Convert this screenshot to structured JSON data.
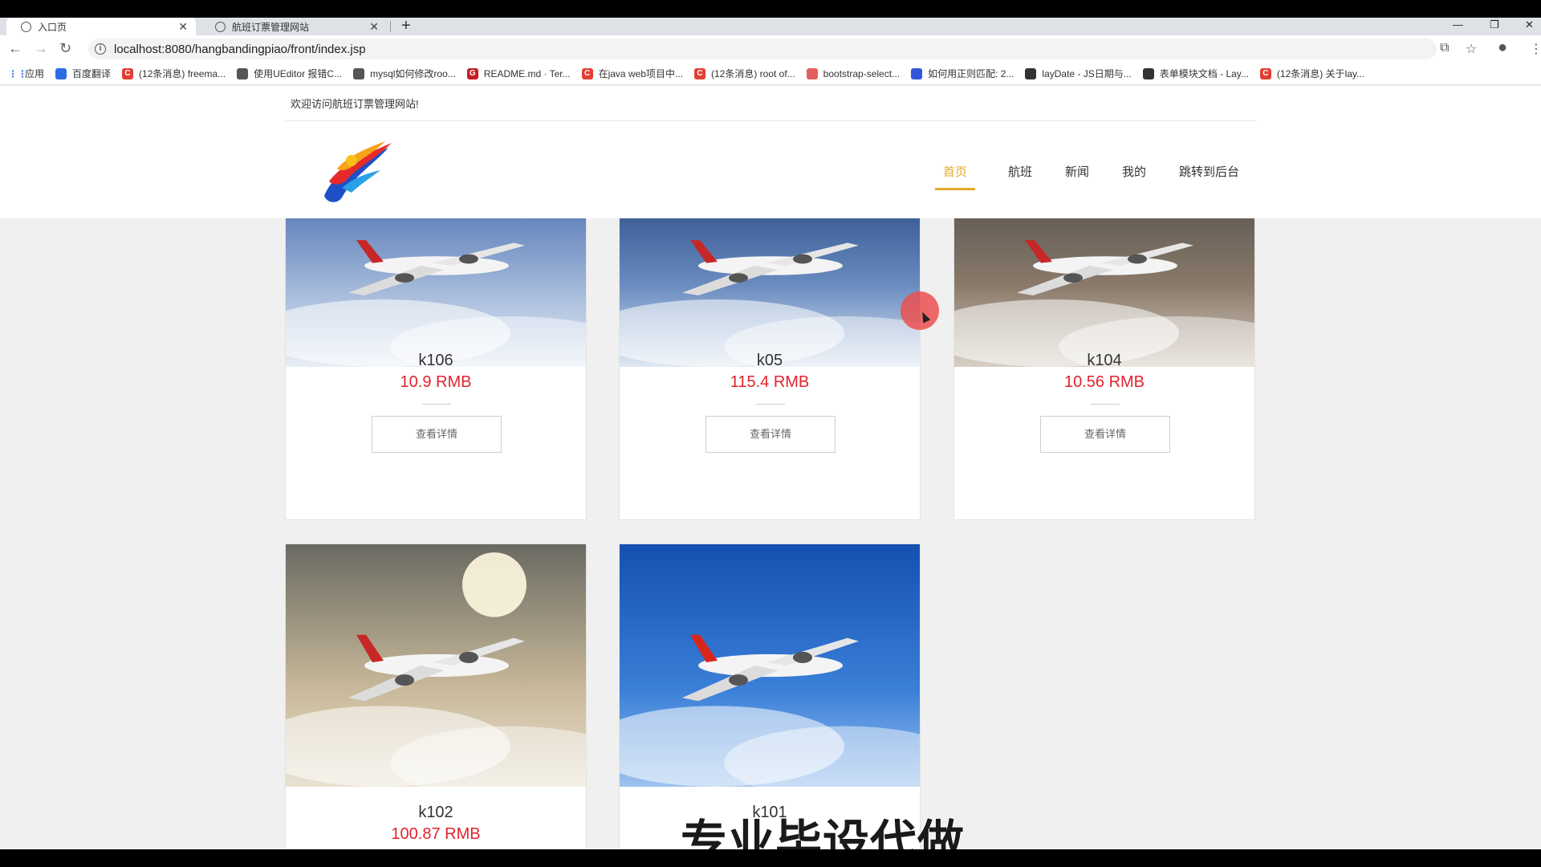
{
  "browser": {
    "tabs": [
      {
        "title": "入口页",
        "active": true
      },
      {
        "title": "航班订票管理网站",
        "active": false
      }
    ],
    "url": "localhost:8080/hangbandingpiao/front/index.jsp",
    "bookmarks": [
      {
        "label": "应用",
        "icon": "apps-grid-icon",
        "color": "#4285f4"
      },
      {
        "label": "百度翻译",
        "icon": "baidu-translate-icon",
        "color": "#2b6de5"
      },
      {
        "label": "(12条消息) freema...",
        "icon": "csdn-icon",
        "color": "#e33e33"
      },
      {
        "label": "使用UEditor 报错C...",
        "icon": "link-icon",
        "color": "#555555"
      },
      {
        "label": "mysql如何修改roo...",
        "icon": "link-icon",
        "color": "#555555"
      },
      {
        "label": "README.md · Ter...",
        "icon": "gitee-icon",
        "color": "#c71d23"
      },
      {
        "label": "在java web项目中...",
        "icon": "csdn-icon",
        "color": "#e33e33"
      },
      {
        "label": "(12条消息) root of...",
        "icon": "csdn-icon",
        "color": "#e33e33"
      },
      {
        "label": "bootstrap-select...",
        "icon": "bookmark-icon",
        "color": "#e35d5d"
      },
      {
        "label": "如何用正则匹配: 2...",
        "icon": "baidu-paw-icon",
        "color": "#3355dd"
      },
      {
        "label": "layDate - JS日期与...",
        "icon": "layui-icon",
        "color": "#333333"
      },
      {
        "label": "表单模块文档 - Lay...",
        "icon": "layui-icon",
        "color": "#333333"
      },
      {
        "label": "(12条消息) 关于lay...",
        "icon": "csdn-icon",
        "color": "#e33e33"
      }
    ]
  },
  "site": {
    "welcome": "欢迎访问航班订票管理网站!",
    "nav": [
      {
        "label": "首页",
        "active": true
      },
      {
        "label": "航班",
        "active": false
      },
      {
        "label": "新闻",
        "active": false
      },
      {
        "label": "我的",
        "active": false
      },
      {
        "label": "跳转到后台",
        "active": false
      }
    ],
    "accent_color": "#e3a92a",
    "price_color": "#e0232d"
  },
  "flights": [
    {
      "name": "k106",
      "price": "10.9 RMB",
      "button": "查看详情"
    },
    {
      "name": "k05",
      "price": "115.4 RMB",
      "button": "查看详情"
    },
    {
      "name": "k104",
      "price": "10.56 RMB",
      "button": "查看详情"
    },
    {
      "name": "k102",
      "price": "100.87 RMB"
    },
    {
      "name": "k101",
      "price": ""
    }
  ],
  "overlay_text": "专业毕设代做"
}
